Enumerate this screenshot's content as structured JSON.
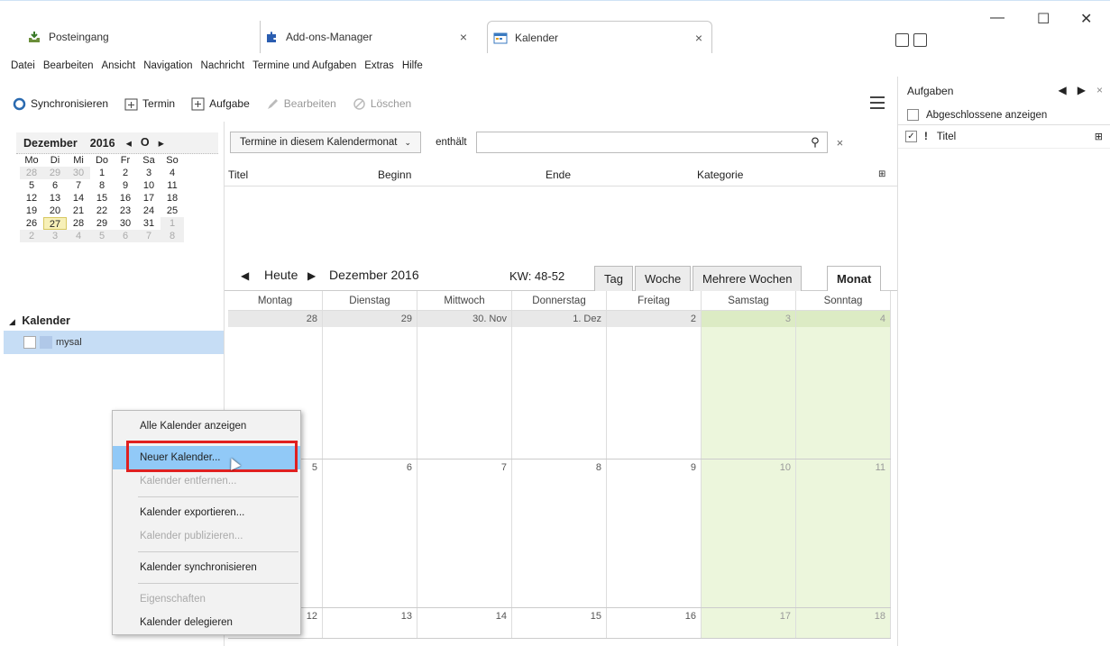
{
  "tabs": {
    "inbox": {
      "label": "Posteingang"
    },
    "addons": {
      "label": "Add-ons-Manager"
    },
    "calendar": {
      "label": "Kalender"
    }
  },
  "menubar": [
    "Datei",
    "Bearbeiten",
    "Ansicht",
    "Navigation",
    "Nachricht",
    "Termine und Aufgaben",
    "Extras",
    "Hilfe"
  ],
  "toolbar": {
    "sync": "Synchronisieren",
    "event": "Termin",
    "task": "Aufgabe",
    "edit": "Bearbeiten",
    "delete": "Löschen"
  },
  "minimonth": {
    "month": "Dezember",
    "year": "2016",
    "weekdays": [
      "Mo",
      "Di",
      "Mi",
      "Do",
      "Fr",
      "Sa",
      "So"
    ],
    "weeks": [
      [
        "28",
        "29",
        "30",
        "1",
        "2",
        "3",
        "4"
      ],
      [
        "5",
        "6",
        "7",
        "8",
        "9",
        "10",
        "11"
      ],
      [
        "12",
        "13",
        "14",
        "15",
        "16",
        "17",
        "18"
      ],
      [
        "19",
        "20",
        "21",
        "22",
        "23",
        "24",
        "25"
      ],
      [
        "26",
        "27",
        "28",
        "29",
        "30",
        "31",
        "1"
      ],
      [
        "2",
        "3",
        "4",
        "5",
        "6",
        "7",
        "8"
      ]
    ]
  },
  "calendar_list": {
    "header": "Kalender",
    "item": "mysal"
  },
  "filter": {
    "select": "Termine in diesem Kalendermonat",
    "contains": "enthält"
  },
  "event_list": {
    "columns": [
      "Titel",
      "Beginn",
      "Ende",
      "Kategorie"
    ]
  },
  "nav": {
    "today": "Heute",
    "month_label": "Dezember 2016",
    "week_label": "KW: 48-52",
    "views": [
      "Tag",
      "Woche",
      "Mehrere Wochen",
      "Monat"
    ]
  },
  "month_view": {
    "weekdays": [
      "Montag",
      "Dienstag",
      "Mittwoch",
      "Donnerstag",
      "Freitag",
      "Samstag",
      "Sonntag"
    ],
    "weeks": [
      [
        "28",
        "29",
        "30. Nov",
        "1. Dez",
        "2",
        "3",
        "4"
      ],
      [
        "5",
        "6",
        "7",
        "8",
        "9",
        "10",
        "11"
      ],
      [
        "12",
        "13",
        "14",
        "15",
        "16",
        "17",
        "18"
      ]
    ]
  },
  "tasks_pane": {
    "title": "Aufgaben",
    "show_completed": "Abgeschlossene anzeigen",
    "col_title": "Titel"
  },
  "context_menu": {
    "show_all": "Alle Kalender anzeigen",
    "new": "Neuer Kalender...",
    "remove": "Kalender entfernen...",
    "export": "Kalender exportieren...",
    "publish": "Kalender publizieren...",
    "sync": "Kalender synchronisieren",
    "properties": "Eigenschaften",
    "delegate": "Kalender delegieren"
  },
  "colors": {
    "weekend": "#ecf6dc",
    "selection": "#c6ddf5",
    "highlight": "#e02020"
  }
}
